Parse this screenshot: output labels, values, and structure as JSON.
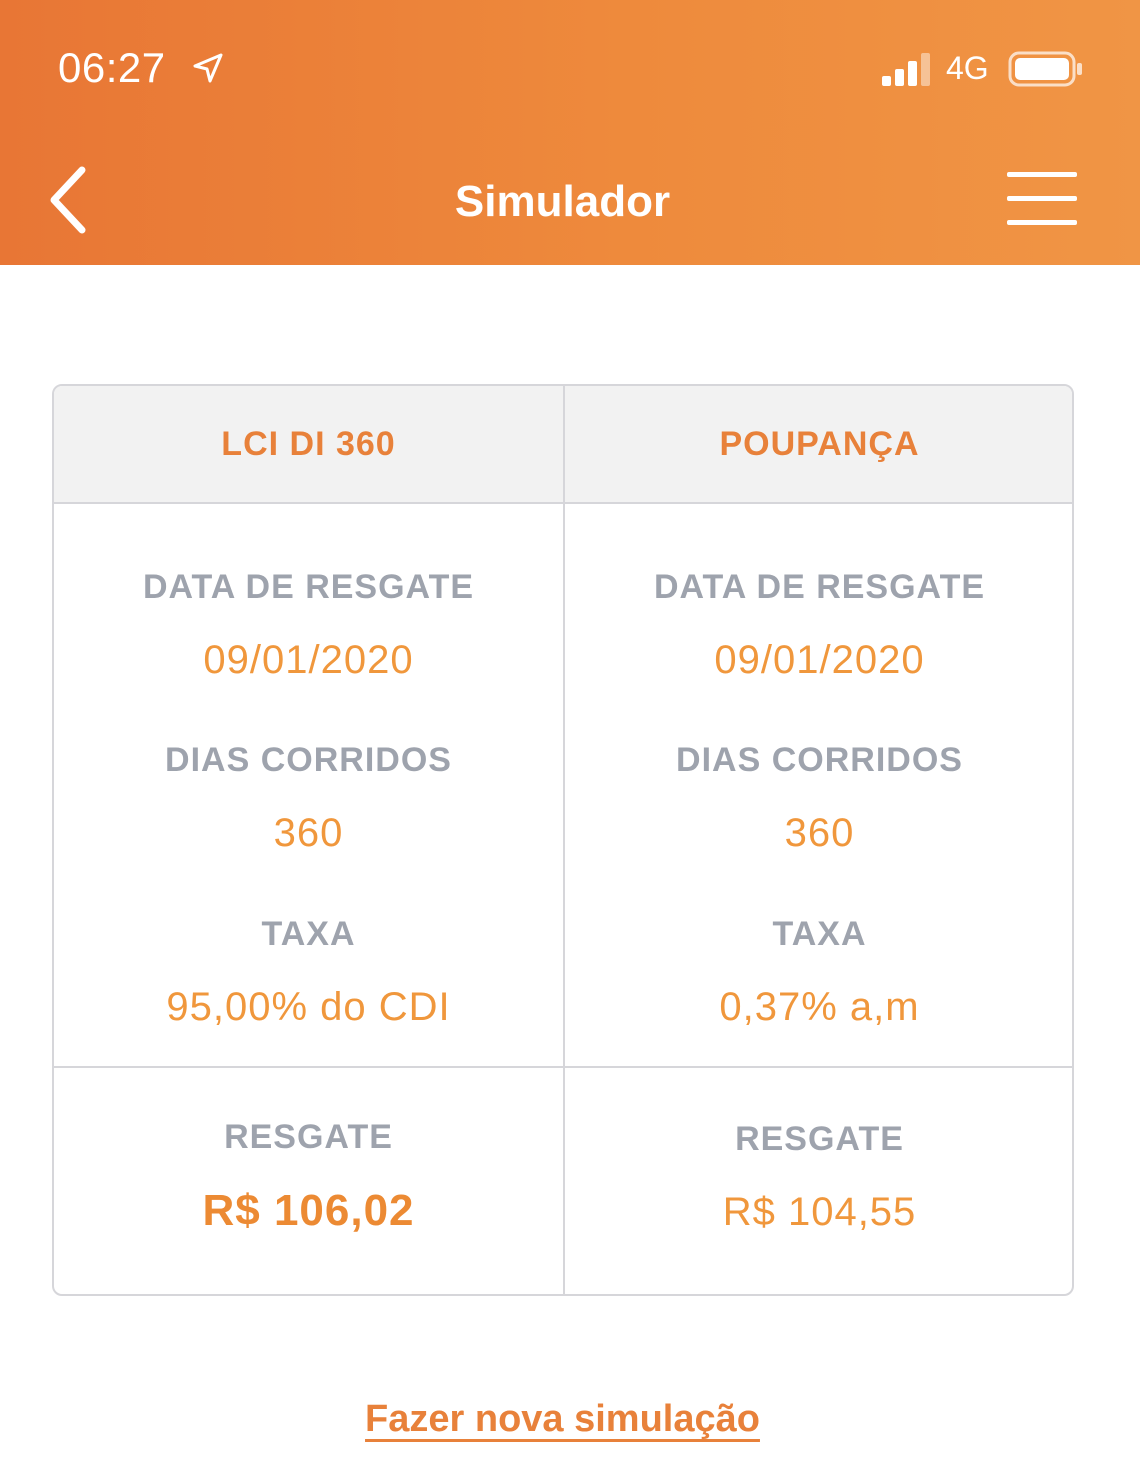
{
  "status_bar": {
    "time": "06:27",
    "network": "4G"
  },
  "nav": {
    "title": "Simulador"
  },
  "comparison": [
    {
      "product": "LCI DI 360",
      "redemption_date_label": "DATA DE RESGATE",
      "redemption_date": "09/01/2020",
      "days_label": "DIAS CORRIDOS",
      "days": "360",
      "rate_label": "TAXA",
      "rate": "95,00% do CDI",
      "redemption_label": "RESGATE",
      "redemption_value": "R$  106,02"
    },
    {
      "product": "POUPANÇA",
      "redemption_date_label": "DATA DE RESGATE",
      "redemption_date": "09/01/2020",
      "days_label": "DIAS CORRIDOS",
      "days": "360",
      "rate_label": "TAXA",
      "rate": "0,37% a,m",
      "redemption_label": "RESGATE",
      "redemption_value": "R$  104,55"
    }
  ],
  "actions": {
    "new_simulation": "Fazer nova simulação"
  },
  "colors": {
    "header_gradient_start": "#e87635",
    "header_gradient_end": "#f09545",
    "accent": "#e8813a",
    "label_gray": "#9ea3ad"
  }
}
